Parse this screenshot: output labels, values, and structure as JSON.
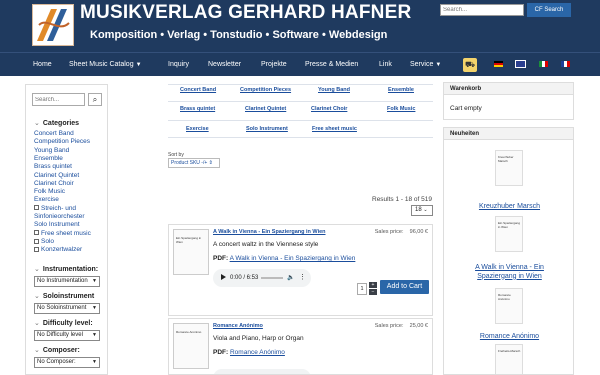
{
  "header": {
    "title": "MUSIKVERLAG GERHARD HAFNER",
    "subtitle": "Komposition • Verlag • Tonstudio • Software • Webdesign",
    "search_placeholder": "Search...",
    "search_button": "CF Search"
  },
  "nav": {
    "items": [
      "Home",
      "Sheet Music Catalog",
      "Inquiry",
      "Newsletter",
      "Projekte",
      "Presse & Medien",
      "Link",
      "Service"
    ],
    "caret": "▼"
  },
  "sidebar": {
    "search_placeholder": "Search...",
    "categories_heading": "Categories",
    "categories": [
      "Concert Band",
      "Competition Pieces",
      "Young Band",
      "Ensemble",
      "Brass quintet",
      "Clarinet Quintet",
      "Clarinet Choir",
      "Folk Music",
      "Exercise"
    ],
    "checkbox_categories": [
      "Streich- und Sinfonieorchester",
      "Free sheet music",
      "Solo",
      "Konzertwalzer"
    ],
    "solo_instrument_link": "Solo Instrument",
    "filters": [
      {
        "label": "Instrumentation:",
        "value": "No Instrumentation"
      },
      {
        "label": "Soloinstrument",
        "value": "No Soloinstrument"
      },
      {
        "label": "Difficulty level:",
        "value": "No Difficulty level"
      },
      {
        "label": "Composer:",
        "value": "No Composer:"
      }
    ]
  },
  "category_grid": [
    [
      "Concert Band",
      "Competition Pieces",
      "Young Band",
      "Ensemble"
    ],
    [
      "Brass quintet",
      "Clarinet Quintet",
      "Clarinet Choir",
      "Folk Music"
    ],
    [
      "Exercise",
      "Solo Instrument",
      "Free sheet music"
    ]
  ],
  "sort": {
    "label": "Sort by",
    "value": "Product SKU  -/+  ⇕"
  },
  "results": {
    "text": "Results 1 - 18 of 519",
    "per_page": "18"
  },
  "products": [
    {
      "name": "A Walk in Vienna - Ein Spaziergang in Wien",
      "price_label": "Sales price:",
      "price": "96,00 €",
      "description": "A concert waltz in the Viennese style",
      "pdf_label": "PDF:",
      "pdf_link": "A Walk in Vienna - Ein Spaziergang in Wien",
      "audio_time": "0:00 / 6:53",
      "qty": "1",
      "thumb_text": "Ein Spaziergang in Wien",
      "add_to_cart": "Add to Cart"
    },
    {
      "name": "Romance Anónimo",
      "price_label": "Sales price:",
      "price": "25,00 €",
      "description": "Viola and Piano, Harp or Organ",
      "pdf_label": "PDF:",
      "pdf_link": "Romance Anónimo",
      "thumb_text": "Romance Anónimo"
    }
  ],
  "cart_panel": {
    "title": "Warenkorb",
    "status": "Cart empty"
  },
  "news_panel": {
    "title": "Neuheiten",
    "items": [
      "Kreuzhuber Marsch",
      "A Walk in Vienna - Ein Spaziergang in Wien",
      "Romance Anónimo"
    ],
    "thumb_texts": [
      "Kreuzhuber Marsch",
      "Ein Spaziergang in Wien",
      "Romance Anónimo",
      "Freiheits-Marsch"
    ]
  },
  "colors": {
    "header_bg": "#1f3a5f",
    "accent": "#2a66a8",
    "link": "#1a4d9c"
  }
}
